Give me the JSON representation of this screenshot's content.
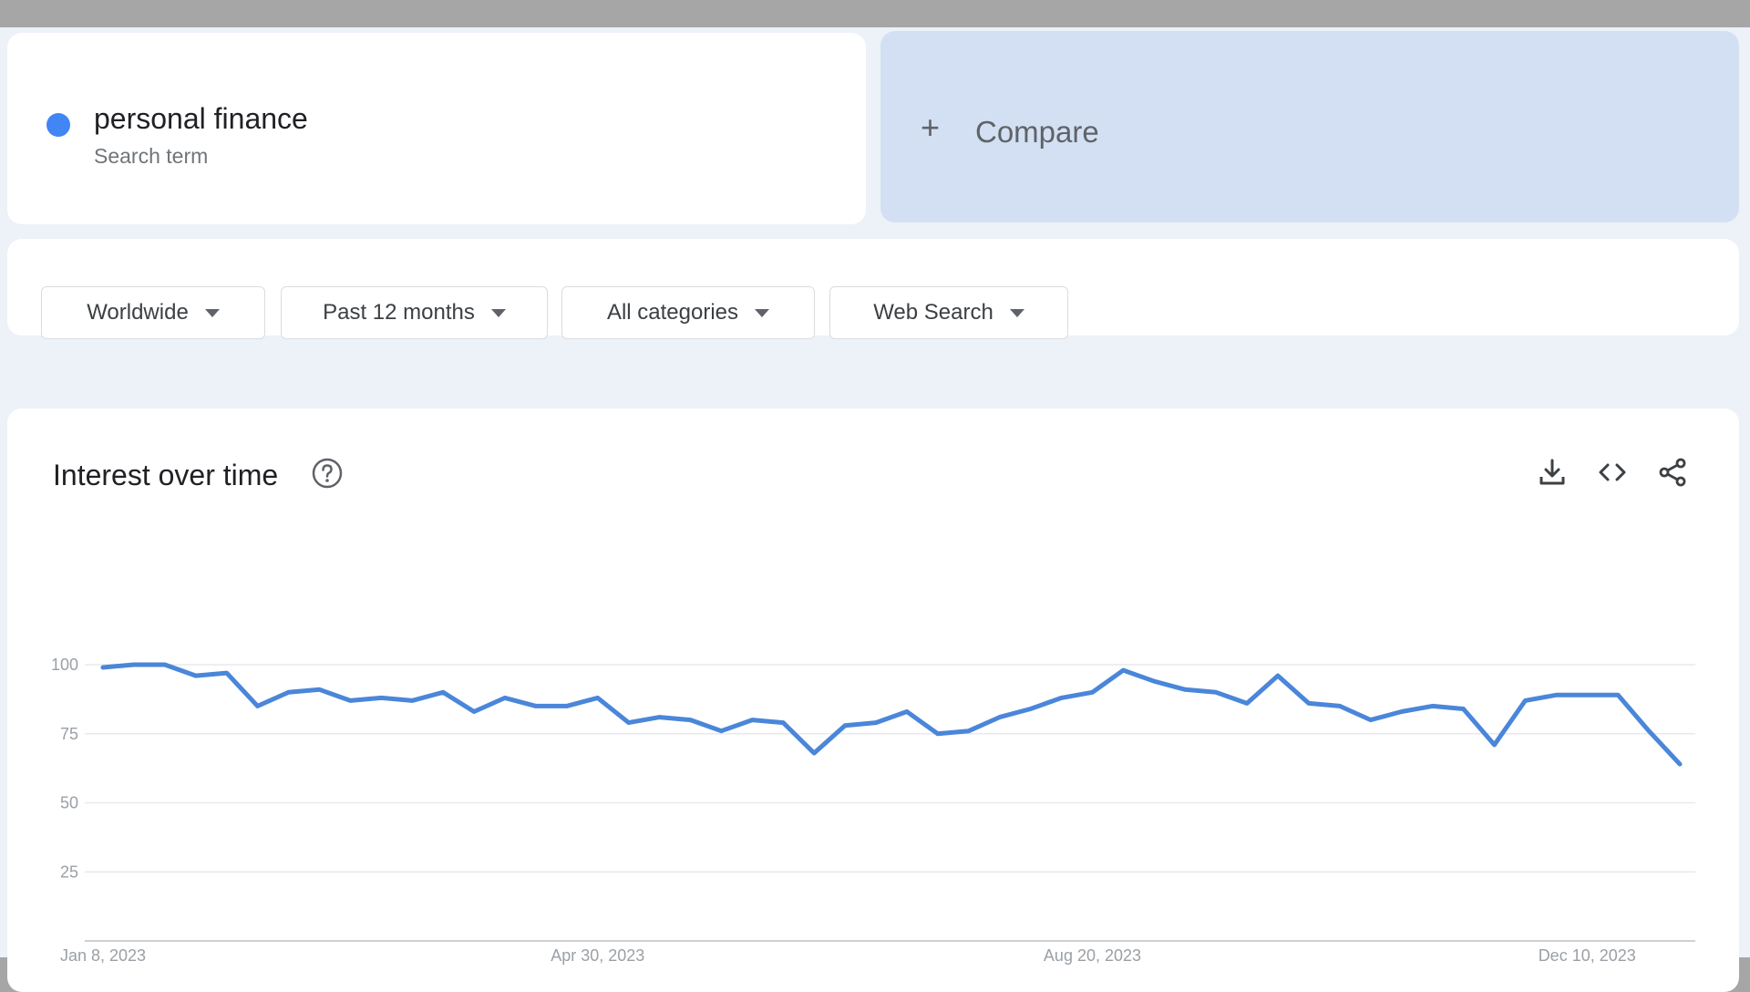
{
  "search_term": {
    "name": "personal finance",
    "subtitle": "Search term",
    "color": "#4285f4"
  },
  "compare": {
    "icon": "+",
    "label": "Compare"
  },
  "filters": [
    {
      "label": "Worldwide"
    },
    {
      "label": "Past 12 months"
    },
    {
      "label": "All categories"
    },
    {
      "label": "Web Search"
    }
  ],
  "chart_header": {
    "title": "Interest over time",
    "help_icon": "help-circle-icon",
    "tools": [
      "download-icon",
      "embed-code-icon",
      "share-icon"
    ]
  },
  "chart_data": {
    "type": "line",
    "title": "Interest over time",
    "xlabel": "",
    "ylabel": "",
    "ylim": [
      0,
      100
    ],
    "yticks": [
      25,
      50,
      75,
      100
    ],
    "xticks": [
      "Jan 8, 2023",
      "Apr 30, 2023",
      "Aug 20, 2023",
      "Dec 10, 2023"
    ],
    "xtick_indices": [
      0,
      16,
      32,
      48
    ],
    "grid": true,
    "series": [
      {
        "color": "#4a86d9",
        "values": [
          99,
          100,
          100,
          96,
          97,
          85,
          90,
          91,
          87,
          88,
          87,
          90,
          83,
          88,
          85,
          85,
          88,
          79,
          81,
          80,
          76,
          80,
          79,
          68,
          78,
          79,
          83,
          75,
          76,
          81,
          84,
          88,
          90,
          98,
          94,
          91,
          90,
          86,
          96,
          86,
          85,
          80,
          83,
          85,
          84,
          71,
          87,
          89,
          89,
          89,
          76,
          64
        ]
      }
    ]
  }
}
